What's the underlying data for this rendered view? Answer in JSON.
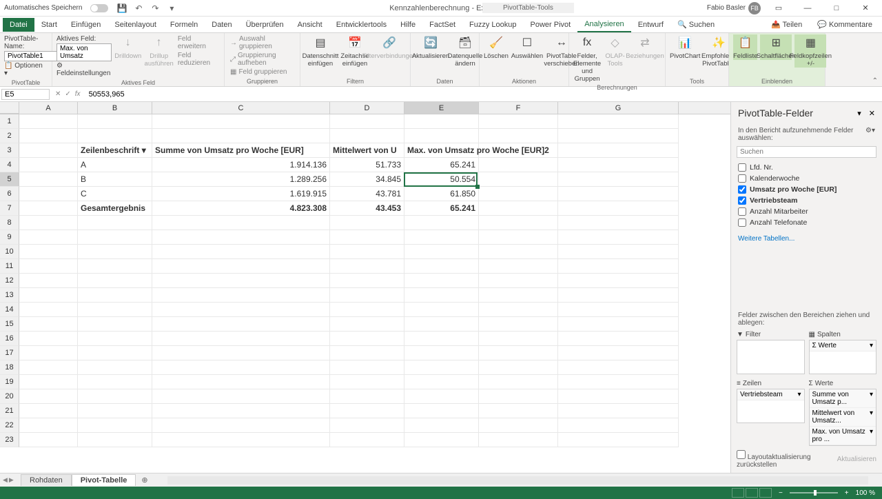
{
  "titlebar": {
    "autosave": "Automatisches Speichern",
    "doc_title": "Kennzahlenberechnung - Excel",
    "tools_title": "PivotTable-Tools",
    "user_name": "Fabio Basler",
    "user_initials": "FB"
  },
  "tabs": {
    "file": "Datei",
    "items": [
      "Start",
      "Einfügen",
      "Seitenlayout",
      "Formeln",
      "Daten",
      "Überprüfen",
      "Ansicht",
      "Entwicklertools",
      "Hilfe",
      "FactSet",
      "Fuzzy Lookup",
      "Power Pivot",
      "Analysieren",
      "Entwurf"
    ],
    "active": "Analysieren",
    "search": "Suchen",
    "share": "Teilen",
    "comments": "Kommentare"
  },
  "ribbon": {
    "pt_name_label": "PivotTable-Name:",
    "pt_name": "PivotTable1",
    "options": "Optionen",
    "group_pivot": "PivotTable",
    "active_field_label": "Aktives Feld:",
    "active_field": "Max. von Umsatz",
    "field_settings": "Feldeinstellungen",
    "drilldown": "Drilldown",
    "drillup": "Drillup ausführen",
    "expand": "Feld erweitern",
    "collapse": "Feld reduzieren",
    "group_active": "Aktives Feld",
    "grp_select": "Auswahl gruppieren",
    "grp_ungroup": "Gruppierung aufheben",
    "grp_field": "Feld gruppieren",
    "group_group": "Gruppieren",
    "slicer": "Datenschnitt einfügen",
    "timeline": "Zeitachse einfügen",
    "filter_conn": "Filterverbindungen",
    "group_filter": "Filtern",
    "refresh": "Aktualisieren",
    "datasource": "Datenquelle ändern",
    "group_data": "Daten",
    "clear": "Löschen",
    "select": "Auswählen",
    "move": "PivotTable verschieben",
    "group_actions": "Aktionen",
    "fields_items": "Felder, Elemente und Gruppen",
    "olap": "OLAP-Tools",
    "relations": "Beziehungen",
    "group_calc": "Berechnungen",
    "pivotchart": "PivotChart",
    "recommended": "Empfohlene PivotTables",
    "group_tools": "Tools",
    "fieldlist": "Feldliste",
    "buttons": "Schaltflächen",
    "headers": "Feldkopfzeilen +/-",
    "group_show": "Einblenden"
  },
  "formula": {
    "cell_ref": "E5",
    "value": "50553,965"
  },
  "columns": [
    "A",
    "B",
    "C",
    "D",
    "E",
    "F",
    "G"
  ],
  "sheet": {
    "headers": {
      "b3": "Zeilenbeschrift",
      "c3": "Summe von Umsatz pro Woche [EUR]",
      "d3": "Mittelwert von U",
      "e3": "Max. von Umsatz pro Woche [EUR]2"
    },
    "rows": [
      {
        "label": "A",
        "sum": "1.914.136",
        "avg": "51.733",
        "max": "65.241"
      },
      {
        "label": "B",
        "sum": "1.289.256",
        "avg": "34.845",
        "max": "50.554"
      },
      {
        "label": "C",
        "sum": "1.619.915",
        "avg": "43.781",
        "max": "61.850"
      }
    ],
    "total_label": "Gesamtergebnis",
    "total": {
      "sum": "4.823.308",
      "avg": "43.453",
      "max": "65.241"
    }
  },
  "pane": {
    "title": "PivotTable-Felder",
    "subtitle": "In den Bericht aufzunehmende Felder auswählen:",
    "search_placeholder": "Suchen",
    "fields": [
      {
        "label": "Lfd. Nr.",
        "checked": false
      },
      {
        "label": "Kalenderwoche",
        "checked": false
      },
      {
        "label": "Umsatz pro Woche [EUR]",
        "checked": true
      },
      {
        "label": "Vertriebsteam",
        "checked": true
      },
      {
        "label": "Anzahl Mitarbeiter",
        "checked": false
      },
      {
        "label": "Anzahl Telefonate",
        "checked": false
      }
    ],
    "more_tables": "Weitere Tabellen...",
    "instruction": "Felder zwischen den Bereichen ziehen und ablegen:",
    "area_filter": "Filter",
    "area_columns": "Spalten",
    "area_rows": "Zeilen",
    "area_values": "Werte",
    "col_item": "Σ Werte",
    "row_item": "Vertriebsteam",
    "value_items": [
      "Summe von Umsatz p...",
      "Mittelwert von Umsatz...",
      "Max. von Umsatz pro ..."
    ],
    "defer": "Layoutaktualisierung zurückstellen",
    "update": "Aktualisieren"
  },
  "tabs_bottom": {
    "sheets": [
      "Rohdaten",
      "Pivot-Tabelle"
    ],
    "active": "Pivot-Tabelle"
  },
  "status": {
    "zoom": "100 %"
  }
}
